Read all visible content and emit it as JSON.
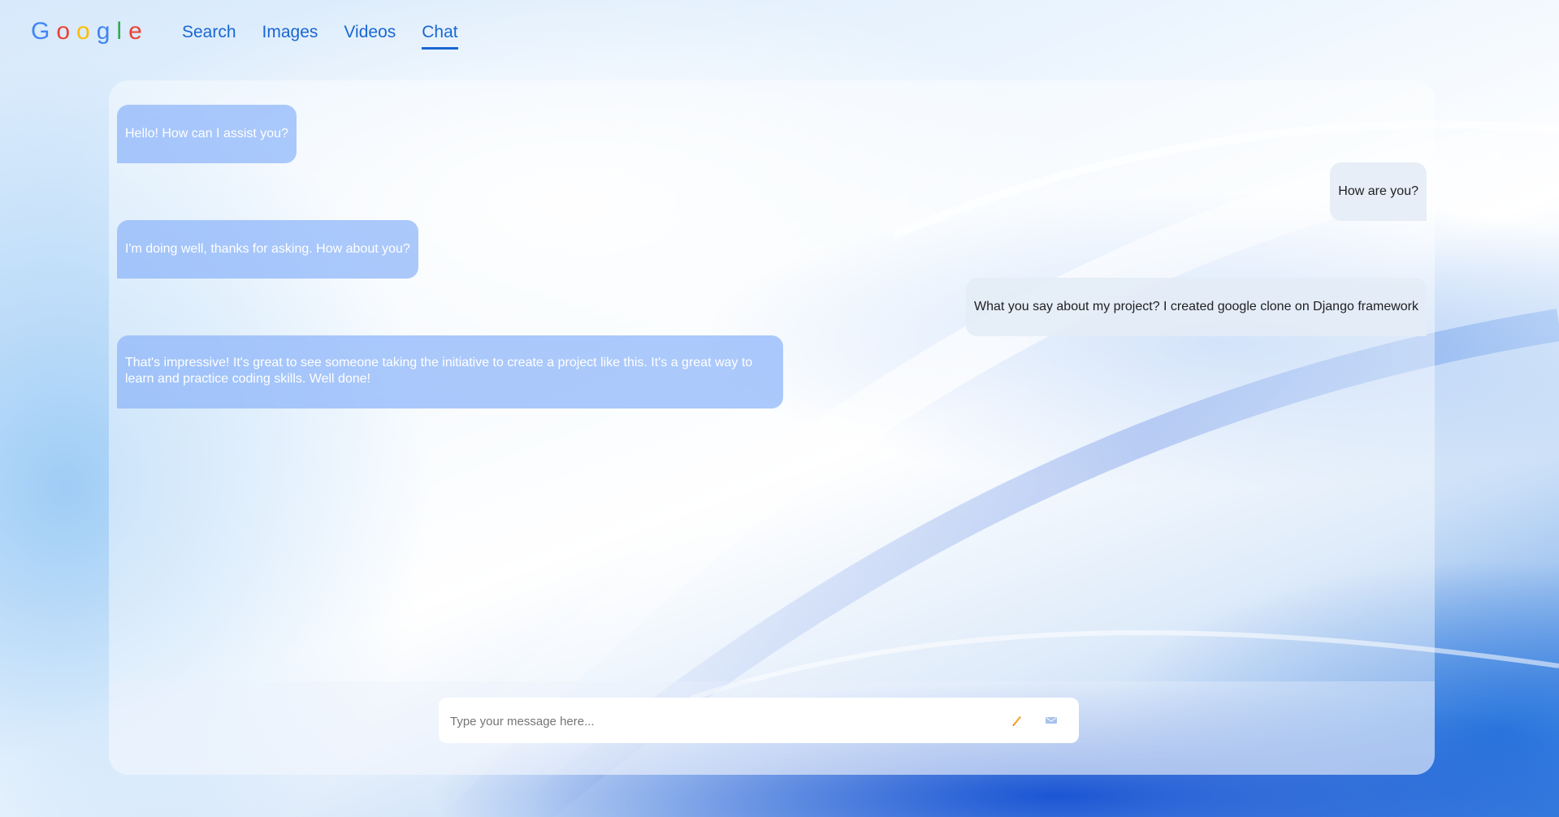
{
  "logo": {
    "letters": [
      {
        "char": "G",
        "color": "#4285f4"
      },
      {
        "char": "o",
        "color": "#ea4335"
      },
      {
        "char": "o",
        "color": "#fbbc05"
      },
      {
        "char": "g",
        "color": "#4285f4"
      },
      {
        "char": "l",
        "color": "#34a853"
      },
      {
        "char": "e",
        "color": "#ea4335"
      }
    ]
  },
  "nav": {
    "items": [
      {
        "label": "Search"
      },
      {
        "label": "Images"
      },
      {
        "label": "Videos"
      },
      {
        "label": "Chat",
        "active": true
      }
    ]
  },
  "chat": {
    "messages": [
      {
        "role": "bot",
        "text": "Hello! How can I assist you?"
      },
      {
        "role": "user",
        "text": "How are you?"
      },
      {
        "role": "bot",
        "text": "I'm doing well, thanks for asking. How about you?"
      },
      {
        "role": "user",
        "text": "What you say about my project? I created google clone on Django framework"
      },
      {
        "role": "bot",
        "text": "That's impressive! It's great to see someone taking the initiative to create a project like this. It's a great way to learn and practice coding skills. Well done!"
      }
    ]
  },
  "input": {
    "placeholder": "Type your message here...",
    "value": ""
  },
  "icons": {
    "pencil": "pencil-icon",
    "send": "send-icon"
  },
  "colors": {
    "accent": "#1967d2",
    "bot_bubble": "#8cb4fa",
    "user_bubble": "#e4ecf6"
  }
}
